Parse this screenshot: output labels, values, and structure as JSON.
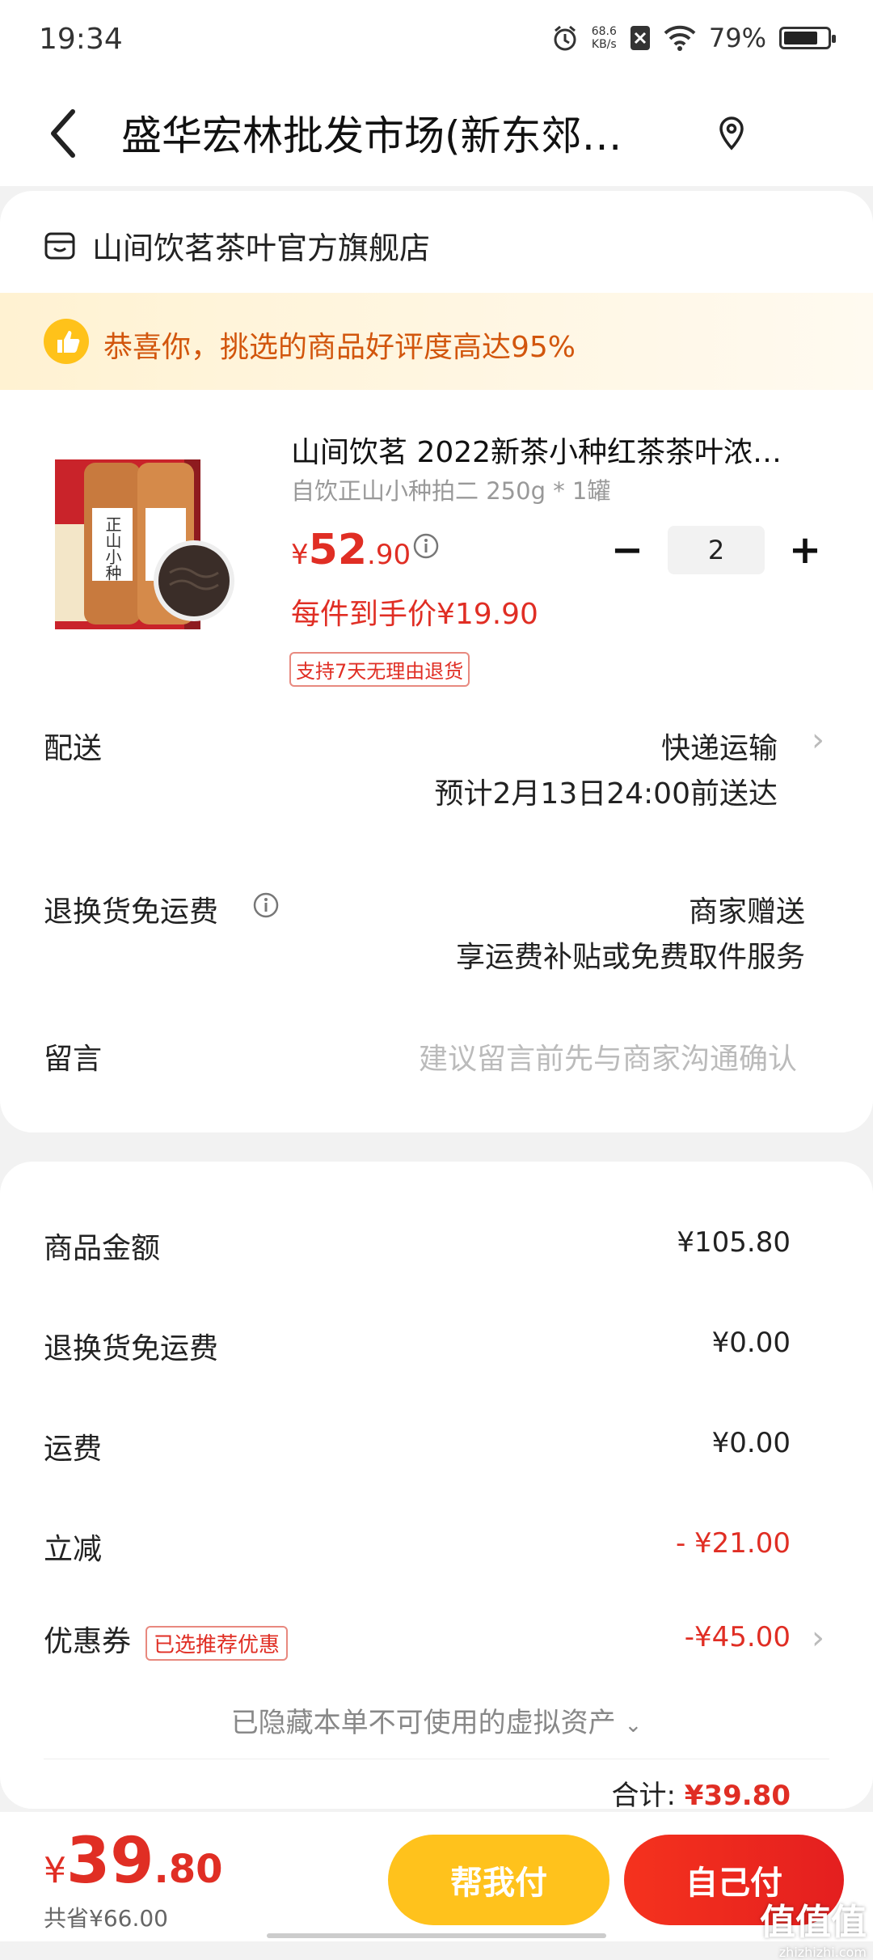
{
  "status_bar": {
    "time": "19:34",
    "net_speed_top": "68.6",
    "net_speed_unit": "KB/s",
    "battery": "79%",
    "battery_level": 0.79
  },
  "header": {
    "title": "盛华宏林批发市场(新东郊…"
  },
  "shop": {
    "name": "山间饮茗茶叶官方旗舰店"
  },
  "banner": {
    "text": "恭喜你，挑选的商品好评度高达95%"
  },
  "product": {
    "name": "山间饮茗 2022新茶小种红茶茶叶浓…",
    "spec": "自饮正山小种拍二 250g * 1罐",
    "price_currency": "¥",
    "price_int": "52",
    "price_dec": ".90",
    "unit_price": "每件到手价¥19.90",
    "return_tag": "支持7天无理由退货",
    "quantity": "2",
    "minus": "−",
    "plus": "+",
    "image_text": "正山小种"
  },
  "delivery": {
    "label": "配送",
    "method": "快递运输",
    "eta": "预计2月13日24:00前送达"
  },
  "return_shipping": {
    "label": "退换货免运费",
    "value": "商家赠送",
    "desc": "享运费补贴或免费取件服务"
  },
  "message": {
    "label": "留言",
    "placeholder": "建议留言前先与商家沟通确认"
  },
  "summary": {
    "goods_label": "商品金额",
    "goods_value": "¥105.80",
    "return_label": "退换货免运费",
    "return_value": "¥0.00",
    "shipping_label": "运费",
    "shipping_value": "¥0.00",
    "discount_label": "立减",
    "discount_value": "- ¥21.00",
    "coupon_label": "优惠券",
    "coupon_tag": "已选推荐优惠",
    "coupon_value": "-¥45.00",
    "hidden_assets": "已隐藏本单不可使用的虚拟资产",
    "total_label": "合计:",
    "total_value": "¥39.80"
  },
  "bottom": {
    "currency": "¥",
    "total_int": "39",
    "total_dec": ".80",
    "saved": "共省¥66.00",
    "help_pay": "帮我付",
    "self_pay": "自己付",
    "watermark": "值值值",
    "watermark_small": "zhizhizhi.com"
  },
  "colors": {
    "accent_red": "#e02e24",
    "help_btn": "#ffc21c",
    "banner_text": "#d2560d"
  }
}
